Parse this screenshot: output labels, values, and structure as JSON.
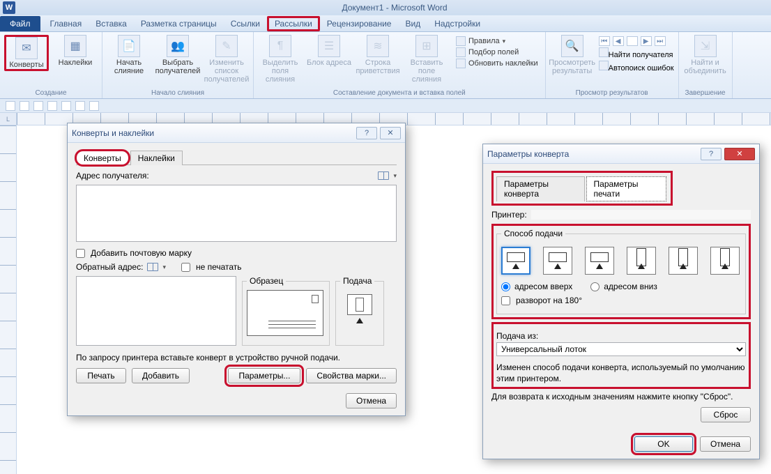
{
  "app": {
    "title": "Документ1 - Microsoft Word",
    "word_badge": "W"
  },
  "tabs": {
    "file": "Файл",
    "items": [
      "Главная",
      "Вставка",
      "Разметка страницы",
      "Ссылки",
      "Рассылки",
      "Рецензирование",
      "Вид",
      "Надстройки"
    ]
  },
  "ribbon": {
    "groups": {
      "create": {
        "label": "Создание",
        "envelopes": "Конверты",
        "labels": "Наклейки"
      },
      "start": {
        "label": "Начало слияния",
        "start_merge": "Начать слияние",
        "select_recipients": "Выбрать получателей",
        "edit_list": "Изменить список получателей"
      },
      "fields": {
        "label": "Составление документа и вставка полей",
        "highlight": "Выделить поля слияния",
        "address_block": "Блок адреса",
        "greeting": "Строка приветствия",
        "insert_field": "Вставить поле слияния",
        "rules": "Правила",
        "match": "Подбор полей",
        "update_labels": "Обновить наклейки"
      },
      "preview": {
        "label": "Просмотр результатов",
        "preview": "Просмотреть результаты",
        "find": "Найти получателя",
        "errors": "Автопоиск ошибок"
      },
      "finish": {
        "label": "Завершение",
        "button": "Найти и объединить"
      }
    }
  },
  "dialog1": {
    "title": "Конверты и наклейки",
    "tab_env": "Конверты",
    "tab_lbl": "Наклейки",
    "recipient_label": "Адрес получателя:",
    "add_stamp": "Добавить почтовую марку",
    "return_label": "Обратный адрес:",
    "no_print": "не печатать",
    "sample": "Образец",
    "feed": "Подача",
    "hint": "По запросу принтера вставьте конверт в устройство ручной подачи.",
    "print": "Печать",
    "add": "Добавить",
    "params": "Параметры...",
    "stamp_props": "Свойства марки...",
    "cancel": "Отмена"
  },
  "dialog2": {
    "title": "Параметры конверта",
    "tab_env": "Параметры конверта",
    "tab_print": "Параметры  печати",
    "printer_label": "Принтер:",
    "feed_group": "Способ подачи",
    "addr_up": "адресом вверх",
    "addr_down": "адресом вниз",
    "rotate": "разворот на 180°",
    "tray_label": "Подача из:",
    "tray_value": "Универсальный лоток",
    "changed_note": "Изменен способ подачи конверта, используемый по умолчанию этим принтером.",
    "reset_note": "Для возврата к исходным значениям нажмите кнопку \"Сброс\".",
    "reset": "Сброс",
    "ok": "OK",
    "cancel": "Отмена"
  }
}
